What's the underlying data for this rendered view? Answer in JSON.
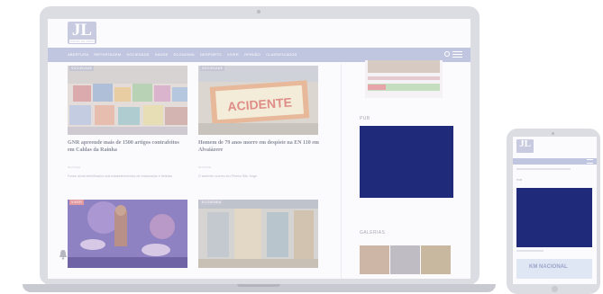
{
  "site": {
    "logo_text": "JL",
    "logo_subtitle": "JORNAL DE LEIRIA"
  },
  "nav": {
    "items": [
      "ABERTURA",
      "REPORTAGEM",
      "SOCIEDADE",
      "SAÚDE",
      "ECONOMIA",
      "DESPORTO",
      "VIVER",
      "OPINIÃO",
      "CLASSIFICADOS"
    ]
  },
  "articles": [
    {
      "tag": "SOCIEDADE",
      "title": "GNR apreende mais de 1500 artigos contrafeitos em Caldas da Rainha",
      "date": "há 2 horas",
      "excerpt": "Foram ainda identificados seis estabelecimentos de restauração e bebidas",
      "image": "t-shirts-on-table"
    },
    {
      "tag": "SOCIEDADE",
      "title": "Homem de 79 anos morre em despiste na EN 110 em Alvaiázere",
      "date": "há 3 horas",
      "excerpt": "O acidente ocorreu em Pereiro São Jorge",
      "image": "acidente-sign",
      "sign_text": "ACIDENTE"
    },
    {
      "tag": "VIVER",
      "title": "",
      "image": "concert-stage"
    },
    {
      "tag": "ECONOMIA",
      "title": "",
      "image": "shop-interior"
    }
  ],
  "sidebar": {
    "pub_label": "PUB",
    "galerias_label": "GALERIAS"
  },
  "phone": {
    "logo_text": "JL",
    "pub_label": "PUB",
    "banner_text": "KM NACIONAL"
  },
  "colors": {
    "nav": "#c1c6e0",
    "ad_box": "#1f2a7a",
    "frame": "#dcdde3"
  }
}
